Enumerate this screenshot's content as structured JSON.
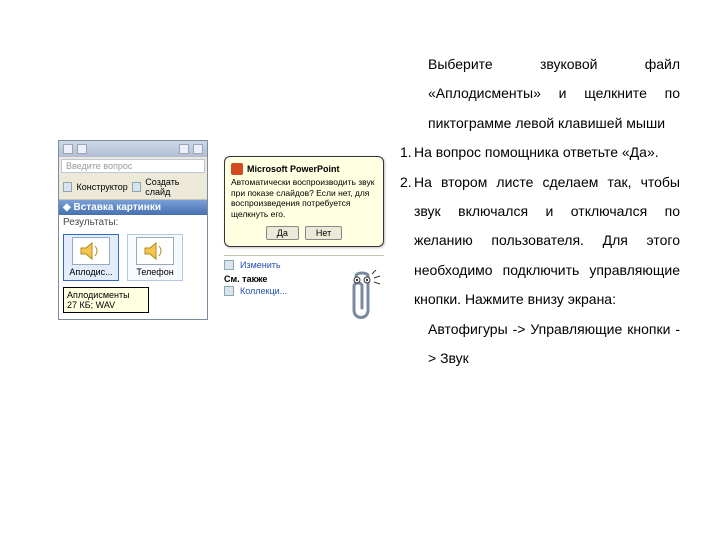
{
  "text": {
    "p0": "Выберите звуковой файл «Аплодисменты» и щелкните по пиктограмме левой клавишей мыши",
    "n1": "1.",
    "p1": "На вопрос помощника ответьте «Да».",
    "n2": "2.",
    "p2": "На втором листе сделаем так, чтобы звук включался и отключался по желанию пользователя. Для этого необходимо подключить управляющие кнопки. Нажмите внизу экрана:",
    "p3": "Автофигуры -> Управляющие кнопки -> Звук"
  },
  "taskpane": {
    "search_placeholder": "Введите вопрос",
    "design_constructor": "Конструктор",
    "design_newslide": "Создать слайд",
    "header": "Вставка картинки",
    "results_label": "Результаты:",
    "item1": "Аплодис...",
    "item2": "Телефон",
    "tooltip": "Аплодисменты\n27 КБ; WAV"
  },
  "assistant": {
    "title": "Microsoft PowerPoint",
    "message": "Автоматически воспроизводить звук при показе слайдов? Если нет, для воспроизведения потребуется щелкнуть его.",
    "yes": "Да",
    "no": "Нет",
    "change": "Изменить",
    "see_also": "См. также",
    "collection": "Коллекци..."
  }
}
